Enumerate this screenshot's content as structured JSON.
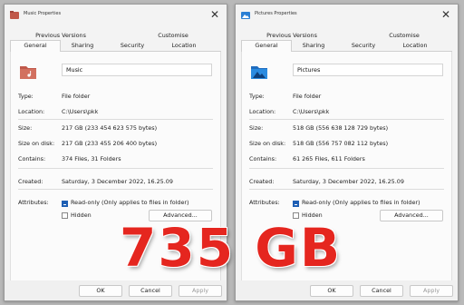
{
  "dialogs": [
    {
      "title": "Music Properties",
      "close": "✕",
      "tabs_row1": [
        "Previous Versions",
        "Customise"
      ],
      "tabs_row2": [
        "General",
        "Sharing",
        "Security",
        "Location"
      ],
      "active_tab": "General",
      "name": "Music",
      "type_label": "Type:",
      "type_value": "File folder",
      "location_label": "Location:",
      "location_value": "C:\\Users\\pkk",
      "size_label": "Size:",
      "size_value": "217 GB (233 454 623 575 bytes)",
      "size_on_disk_label": "Size on disk:",
      "size_on_disk_value": "217 GB (233 455 206 400 bytes)",
      "contains_label": "Contains:",
      "contains_value": "374 Files, 31 Folders",
      "created_label": "Created:",
      "created_value": "Saturday, 3 December 2022, 16.25.09",
      "attributes_label": "Attributes:",
      "readonly_label": "Read-only (Only applies to files in folder)",
      "hidden_label": "Hidden",
      "advanced_label": "Advanced...",
      "ok_label": "OK",
      "cancel_label": "Cancel",
      "apply_label": "Apply",
      "icon": "music-folder-icon"
    },
    {
      "title": "Pictures Properties",
      "close": "✕",
      "tabs_row1": [
        "Previous Versions",
        "Customise"
      ],
      "tabs_row2": [
        "General",
        "Sharing",
        "Security",
        "Location"
      ],
      "active_tab": "General",
      "name": "Pictures",
      "type_label": "Type:",
      "type_value": "File folder",
      "location_label": "Location:",
      "location_value": "C:\\Users\\pkk",
      "size_label": "Size:",
      "size_value": "518 GB (556 638 128 729 bytes)",
      "size_on_disk_label": "Size on disk:",
      "size_on_disk_value": "518 GB (556 757 082 112 bytes)",
      "contains_label": "Contains:",
      "contains_value": "61 265 Files, 611 Folders",
      "created_label": "Created:",
      "created_value": "Saturday, 3 December 2022, 16.25.09",
      "attributes_label": "Attributes:",
      "readonly_label": "Read-only (Only applies to files in folder)",
      "hidden_label": "Hidden",
      "advanced_label": "Advanced...",
      "ok_label": "OK",
      "cancel_label": "Cancel",
      "apply_label": "Apply",
      "icon": "pictures-folder-icon"
    }
  ],
  "overlay": {
    "text": "735 GB",
    "color": "#e5261f"
  },
  "colors": {
    "checkbox_checked": "#1e5fb4",
    "music_icon": "#c0584a",
    "pictures_icon": "#2a7fd4"
  }
}
